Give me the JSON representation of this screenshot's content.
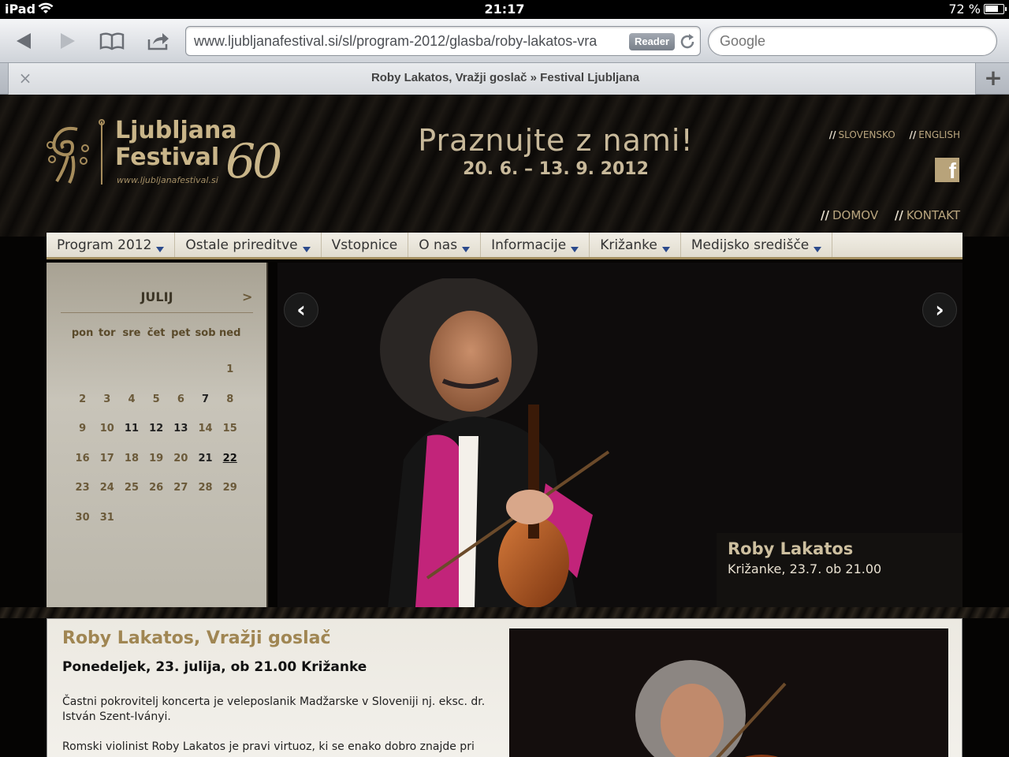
{
  "statusbar": {
    "carrier": "iPad",
    "time": "21:17",
    "battery": "72 %"
  },
  "browser": {
    "url": "www.ljubljanafestival.si/sl/program-2012/glasba/roby-lakatos-vra",
    "reader_label": "Reader",
    "search_placeholder": "Google",
    "tab_title": "Roby Lakatos, Vražji goslač » Festival Ljubljana",
    "tab_close": "×",
    "new_tab": "+"
  },
  "header": {
    "logo_line1": "Ljubljana",
    "logo_line2": "Festival",
    "logo_www": "www.ljubljanafestival.si",
    "logo_number": "60",
    "tagline": "Praznujte z nami!",
    "dates": "20. 6. – 13. 9. 2012",
    "lang_sl": "SLOVENSKO",
    "lang_en": "ENGLISH",
    "sep": "//",
    "fb": "f",
    "link_home": "DOMOV",
    "link_contact": "KONTAKT"
  },
  "nav": {
    "items": [
      {
        "label": "Program 2012",
        "dropdown": true
      },
      {
        "label": "Ostale prireditve",
        "dropdown": true
      },
      {
        "label": "Vstopnice",
        "dropdown": false
      },
      {
        "label": "O nas",
        "dropdown": true
      },
      {
        "label": "Informacije",
        "dropdown": true
      },
      {
        "label": "Križanke",
        "dropdown": true
      },
      {
        "label": "Medijsko središče",
        "dropdown": true
      }
    ]
  },
  "calendar": {
    "month": "JULIJ",
    "next": ">",
    "days": [
      "pon",
      "tor",
      "sre",
      "čet",
      "pet",
      "sob",
      "ned"
    ],
    "weeks": [
      [
        "",
        "",
        "",
        "",
        "",
        "",
        "1"
      ],
      [
        "2",
        "3",
        "4",
        "5",
        "6",
        "7",
        "8"
      ],
      [
        "9",
        "10",
        "11",
        "12",
        "13",
        "14",
        "15"
      ],
      [
        "16",
        "17",
        "18",
        "19",
        "20",
        "21",
        "22"
      ],
      [
        "23",
        "24",
        "25",
        "26",
        "27",
        "28",
        "29"
      ],
      [
        "30",
        "31",
        "",
        "",
        "",
        "",
        ""
      ]
    ],
    "event_days": [
      "7",
      "11",
      "12",
      "13",
      "21"
    ],
    "today": "22"
  },
  "slider": {
    "prev": "‹",
    "next": "›",
    "caption_title": "Roby Lakatos",
    "caption_sub": "Križanke, 23.7. ob 21.00"
  },
  "article": {
    "title": "Roby Lakatos, Vražji goslač",
    "date": "Ponedeljek, 23. julija, ob 21.00 Križanke",
    "p1": "Častni pokrovitelj koncerta je veleposlanik Madžarske v Sloveniji nj. eksc. dr. István Szent-Iványi.",
    "p2": "Romski violinist Roby Lakatos je pravi virtuoz, ki se enako dobro znajde pri"
  },
  "colors": {
    "gold": "#c9b589",
    "nav_arrow": "#2b4a8c",
    "page_bg": "#050403"
  }
}
